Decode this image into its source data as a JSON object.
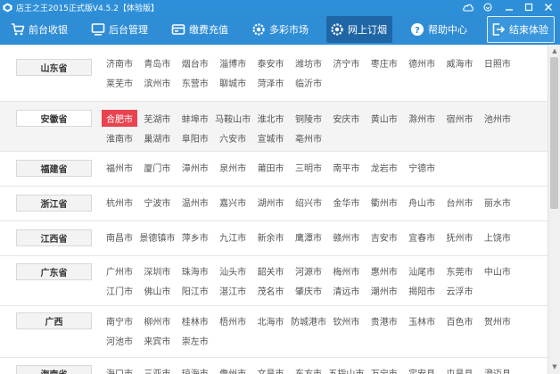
{
  "window": {
    "title": "店王之王2015正式版V4.5.2【体验版】"
  },
  "nav": [
    {
      "id": "front",
      "label": "前台收银",
      "icon": "cart-icon"
    },
    {
      "id": "back",
      "label": "后台管理",
      "icon": "monitor-icon"
    },
    {
      "id": "recharge",
      "label": "缴费充值",
      "icon": "wallet-icon"
    },
    {
      "id": "market",
      "label": "多彩市场",
      "icon": "gear-icon"
    },
    {
      "id": "order",
      "label": "网上订烟",
      "icon": "gear-icon",
      "active": true
    },
    {
      "id": "help",
      "label": "帮助中心",
      "icon": "question-icon"
    },
    {
      "id": "end",
      "label": "结束体验",
      "icon": "exit-icon"
    }
  ],
  "selected_city": "合肥市",
  "provinces": [
    {
      "name": "山东省",
      "cities": [
        "济南市",
        "青岛市",
        "烟台市",
        "淄博市",
        "泰安市",
        "潍坊市",
        "济宁市",
        "枣庄市",
        "德州市",
        "威海市",
        "日照市",
        "莱芜市",
        "滨州市",
        "东营市",
        "聊城市",
        "菏泽市",
        "临沂市"
      ]
    },
    {
      "name": "安徽省",
      "cities": [
        "合肥市",
        "芜湖市",
        "蚌埠市",
        "马鞍山市",
        "淮北市",
        "铜陵市",
        "安庆市",
        "黄山市",
        "滁州市",
        "宿州市",
        "池州市",
        "淮南市",
        "巢湖市",
        "阜阳市",
        "六安市",
        "宣城市",
        "亳州市"
      ]
    },
    {
      "name": "福建省",
      "cities": [
        "福州市",
        "厦门市",
        "漳州市",
        "泉州市",
        "莆田市",
        "三明市",
        "南平市",
        "龙岩市",
        "宁德市"
      ]
    },
    {
      "name": "浙江省",
      "cities": [
        "杭州市",
        "宁波市",
        "温州市",
        "嘉兴市",
        "湖州市",
        "绍兴市",
        "金华市",
        "衢州市",
        "舟山市",
        "台州市",
        "丽水市"
      ]
    },
    {
      "name": "江西省",
      "cities": [
        "南昌市",
        "景德镇市",
        "萍乡市",
        "九江市",
        "新余市",
        "鹰潭市",
        "赣州市",
        "吉安市",
        "宜春市",
        "抚州市",
        "上饶市"
      ]
    },
    {
      "name": "广东省",
      "cities": [
        "广州市",
        "深圳市",
        "珠海市",
        "汕头市",
        "韶关市",
        "河源市",
        "梅州市",
        "惠州市",
        "汕尾市",
        "东莞市",
        "中山市",
        "江门市",
        "佛山市",
        "阳江市",
        "湛江市",
        "茂名市",
        "肇庆市",
        "清远市",
        "潮州市",
        "揭阳市",
        "云浮市"
      ]
    },
    {
      "name": "广西",
      "cities": [
        "南宁市",
        "柳州市",
        "桂林市",
        "梧州市",
        "北海市",
        "防城港市",
        "钦州市",
        "贵港市",
        "玉林市",
        "百色市",
        "贺州市",
        "河池市",
        "来宾市",
        "崇左市"
      ]
    },
    {
      "name": "海南省",
      "cities": [
        "海口市",
        "三亚市",
        "琼海市",
        "儋州市",
        "文昌市",
        "东方市",
        "五指山市",
        "万宁市",
        "定安县",
        "屯昌县",
        "澄迈县"
      ]
    }
  ]
}
